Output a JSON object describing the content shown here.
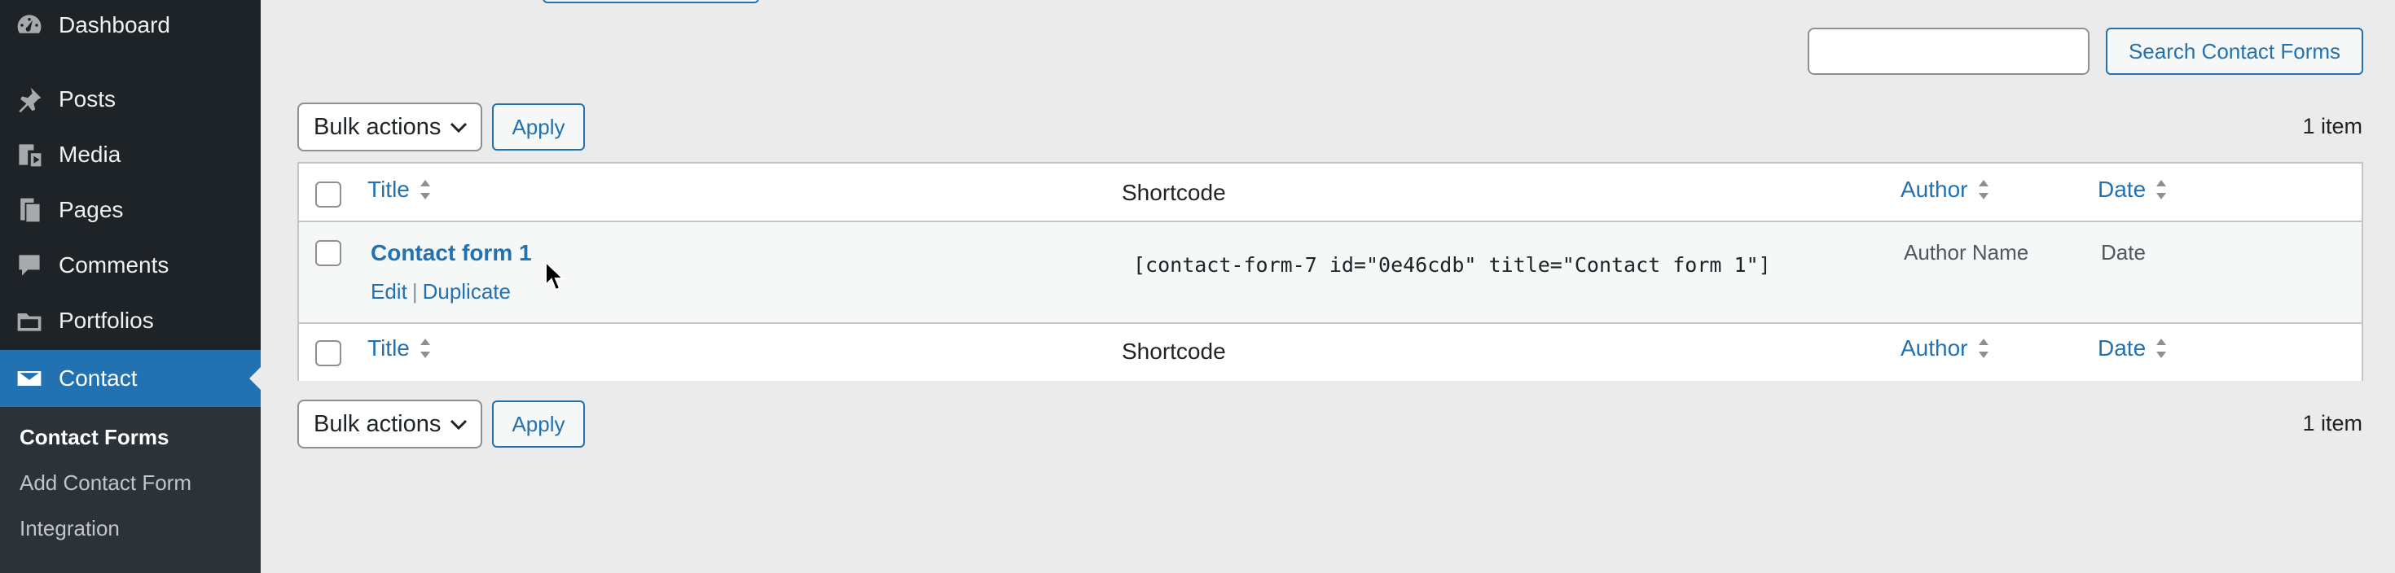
{
  "sidebar": {
    "items": [
      {
        "label": "Dashboard",
        "icon": "dashboard-icon"
      },
      {
        "label": "Posts",
        "icon": "pushpin-icon"
      },
      {
        "label": "Media",
        "icon": "media-icon"
      },
      {
        "label": "Pages",
        "icon": "pages-icon"
      },
      {
        "label": "Comments",
        "icon": "comment-icon"
      },
      {
        "label": "Portfolios",
        "icon": "folder-icon"
      },
      {
        "label": "Contact",
        "icon": "envelope-icon"
      }
    ],
    "submenu": [
      {
        "label": "Contact Forms"
      },
      {
        "label": "Add Contact Form"
      },
      {
        "label": "Integration"
      }
    ]
  },
  "search": {
    "value": "",
    "button_label": "Search Contact Forms"
  },
  "bulk_top": {
    "select_value": "Bulk actions",
    "apply_label": "Apply"
  },
  "bulk_bottom": {
    "select_value": "Bulk actions",
    "apply_label": "Apply"
  },
  "count_top": "1 item",
  "count_bottom": "1 item",
  "table": {
    "columns": {
      "title": "Title",
      "shortcode": "Shortcode",
      "author": "Author",
      "date": "Date"
    },
    "rows": [
      {
        "title": "Contact form 1",
        "actions": {
          "edit": "Edit",
          "sep": "|",
          "duplicate": "Duplicate"
        },
        "shortcode": "[contact-form-7 id=\"0e46cdb\" title=\"Contact form 1\"]",
        "author": "Author Name",
        "date": "Date"
      }
    ]
  },
  "colors": {
    "accent": "#2271b1",
    "sidebar": "#1e2327",
    "submenu": "#2c3338",
    "background": "#ebebeb"
  }
}
